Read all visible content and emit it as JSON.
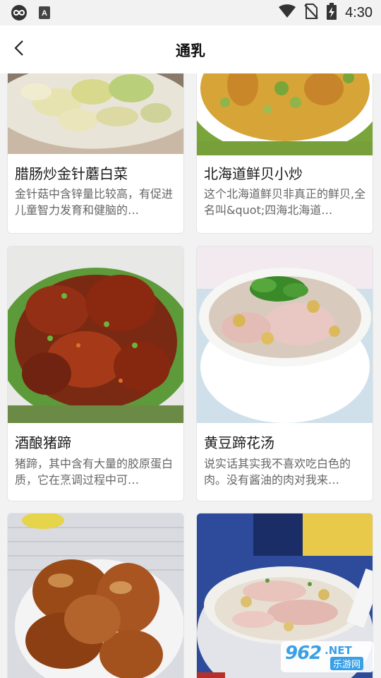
{
  "status_bar": {
    "time": "4:30",
    "icons": [
      "infinity-icon",
      "font-a-icon",
      "wifi-icon",
      "no-sim-icon",
      "battery-charging-icon"
    ]
  },
  "header": {
    "back_icon": "chevron-left-icon",
    "title": "通乳"
  },
  "cards": [
    {
      "title": "腊肠炒金针蘑白菜",
      "desc": "金针菇中含锌量比较高，有促进儿童智力发育和健脑的…"
    },
    {
      "title": "北海道鲜贝小炒",
      "desc": "这个北海道鲜贝非真正的鲜贝,全名叫&quot;四海北海道…"
    },
    {
      "title": "酒酿猪蹄",
      "desc": "猪蹄，其中含有大量的胶原蛋白质，它在烹调过程中可…"
    },
    {
      "title": "黄豆蹄花汤",
      "desc": "说实话其实我不喜欢吃白色的肉。没有酱油的肉对我来…"
    },
    {
      "title": "",
      "desc": ""
    },
    {
      "title": "",
      "desc": ""
    }
  ],
  "watermark": {
    "logo": "962",
    "net": ".NET",
    "sub": "乐游网"
  }
}
